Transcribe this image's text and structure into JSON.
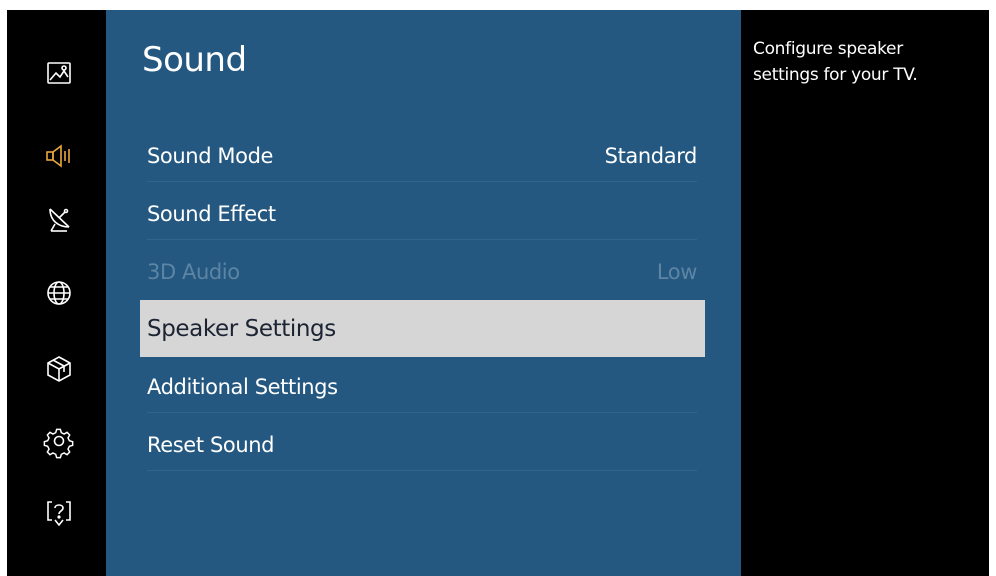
{
  "sidebar": {
    "icons": [
      {
        "name": "picture-icon",
        "active": false
      },
      {
        "name": "sound-icon",
        "active": true
      },
      {
        "name": "broadcasting-icon",
        "active": false
      },
      {
        "name": "network-icon",
        "active": false
      },
      {
        "name": "smart-features-icon",
        "active": false
      },
      {
        "name": "system-icon",
        "active": false
      },
      {
        "name": "support-icon",
        "active": false
      }
    ],
    "active_color": "#e8a73a",
    "icon_color": "#ffffff"
  },
  "panel": {
    "title": "Sound",
    "background": "#245880",
    "items": [
      {
        "label": "Sound Mode",
        "value": "Standard",
        "state": "normal"
      },
      {
        "label": "Sound Effect",
        "value": "",
        "state": "normal"
      },
      {
        "label": "3D Audio",
        "value": "Low",
        "state": "disabled"
      },
      {
        "label": "Speaker Settings",
        "value": "",
        "state": "focused"
      },
      {
        "label": "Additional Settings",
        "value": "",
        "state": "normal"
      },
      {
        "label": "Reset Sound",
        "value": "",
        "state": "normal"
      }
    ]
  },
  "help": {
    "text": "Configure speaker settings for your TV."
  }
}
